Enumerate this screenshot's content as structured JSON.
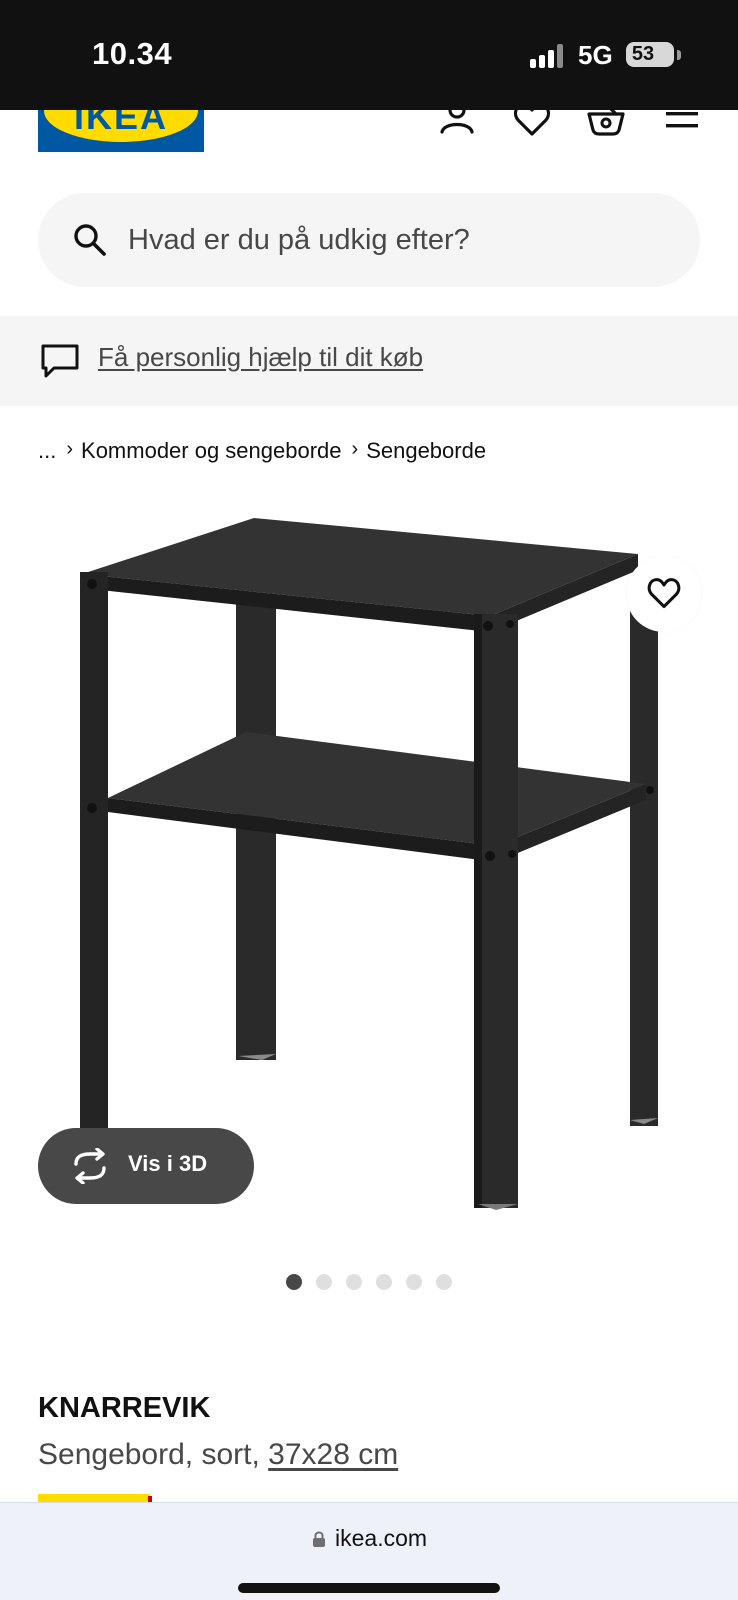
{
  "status_bar": {
    "time": "10.34",
    "network": "5G",
    "battery": "53"
  },
  "header": {
    "logo_text": "IKEA",
    "brand_colors": {
      "blue": "#0058a3",
      "yellow": "#ffdb00"
    },
    "icons": [
      "user-icon",
      "heart-icon",
      "basket-icon",
      "menu-icon"
    ]
  },
  "search": {
    "placeholder": "Hvad er du på udkig efter?"
  },
  "help": {
    "link_text": "Få personlig hjælp til dit køb"
  },
  "breadcrumb": {
    "items": [
      "...",
      "Kommoder og sengeborde",
      "Sengeborde"
    ]
  },
  "gallery": {
    "view_3d_label": "Vis i 3D",
    "image_count": 6,
    "active_index": 0
  },
  "product": {
    "name": "KNARREVIK",
    "description": "Sengebord, sort,",
    "size": "37x28 cm"
  },
  "browser": {
    "url": "ikea.com"
  }
}
